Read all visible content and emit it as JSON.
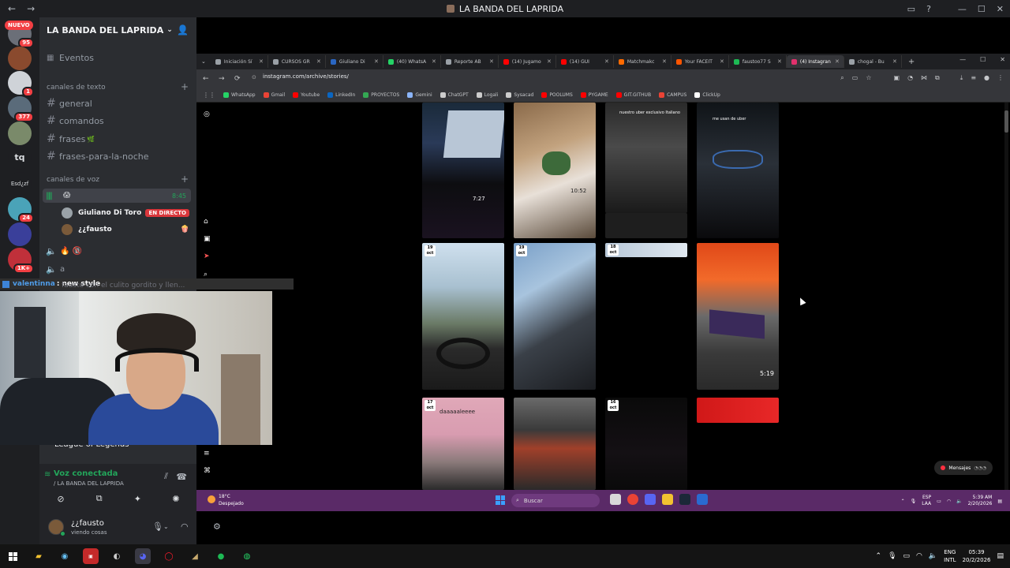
{
  "window": {
    "title": "LA BANDA DEL LAPRIDA",
    "back_label": "←",
    "forward_label": "→",
    "inbox_label": "▭",
    "help_label": "?",
    "minimize_label": "—",
    "maximize_label": "☐",
    "close_label": "✕"
  },
  "rail": {
    "nuevo_label": "NUEVO",
    "servers": [
      {
        "badge": "95",
        "color": "#6b6f78"
      },
      {
        "badge": "",
        "color": "#8a4a2e"
      },
      {
        "badge": "1",
        "color": "#cfd3d8"
      },
      {
        "badge": "377",
        "color": "#5a6b7a"
      },
      {
        "badge": "",
        "color": "#7a8a6a"
      },
      {
        "label": "tq",
        "badge": ""
      },
      {
        "label": "Esd¿zf",
        "badge": ""
      },
      {
        "badge": "24",
        "color": "#4aa3b8"
      },
      {
        "badge": "",
        "color": "#3a3f9a"
      },
      {
        "badge": "1K+",
        "color": "#c0303a"
      }
    ]
  },
  "sidebar": {
    "server_name": "LA BANDA DEL LAPRIDA",
    "chevron": "⌄",
    "events_label": "Eventos",
    "text_category": "canales de texto",
    "text_channels": [
      "general",
      "comandos",
      "frases",
      "frases-para-la-noche"
    ],
    "voice_category": "canales de voz",
    "active_voice": {
      "emoji": "😱",
      "time": "8:45"
    },
    "voice_users": [
      {
        "name": "Giuliano Di Toro",
        "live": "EN DIRECTO"
      },
      {
        "name": "¿¿fausto",
        "live": ""
      }
    ],
    "other_voice": [
      {
        "name": "🔥 🔞"
      },
      {
        "name": "a"
      }
    ],
    "game_activity": "League of Legends",
    "voice_connected": "Voz conectada",
    "voice_server": "/ LA BANDA DEL LAPRIDA",
    "user": {
      "name": "¿¿fausto",
      "status": "viendo cosas"
    }
  },
  "overlay": {
    "chat_user": "valentinna",
    "chat_sep": ":",
    "chat_msg": "new style",
    "ghost_msg": "fausto con el culito gordito y llen..."
  },
  "browser": {
    "tabs": [
      {
        "label": "Iniciación Sí",
        "color": "#9aa0a6"
      },
      {
        "label": "CURSOS GR",
        "color": "#9aa0a6"
      },
      {
        "label": "Giuliano Di",
        "color": "#2a66c2"
      },
      {
        "label": "(40) WhatsA",
        "color": "#25d366"
      },
      {
        "label": "Reporte AB",
        "color": "#9aa0a6"
      },
      {
        "label": "(14) Jugamo",
        "color": "#ff0000"
      },
      {
        "label": "(14) GUI",
        "color": "#ff0000"
      },
      {
        "label": "Matchmakc",
        "color": "#ff6a00"
      },
      {
        "label": "Your FACEIT",
        "color": "#ff5500"
      },
      {
        "label": "faustoo77 S",
        "color": "#1db954"
      },
      {
        "label": "(4) Instagran",
        "color": "#e1306c",
        "active": true
      },
      {
        "label": "chogal - Bu",
        "color": "#9aa0a6"
      }
    ],
    "new_tab": "+",
    "url": "instagram.com/archive/stories/",
    "bookmarks": [
      {
        "label": "WhatsApp",
        "color": "#25d366"
      },
      {
        "label": "Gmail",
        "color": "#ea4335"
      },
      {
        "label": "Youtube",
        "color": "#ff0000"
      },
      {
        "label": "LinkedIn",
        "color": "#0a66c2"
      },
      {
        "label": "PROYECTOS",
        "color": "#34a853"
      },
      {
        "label": "Gemini",
        "color": "#8ab4f8"
      },
      {
        "label": "ChatGPT",
        "color": "#cccccc"
      },
      {
        "label": "Logali",
        "color": "#cccccc"
      },
      {
        "label": "Sysacad",
        "color": "#cccccc"
      },
      {
        "label": "POOLUMS",
        "color": "#ff0000"
      },
      {
        "label": "PYGAME",
        "color": "#ff0000"
      },
      {
        "label": "GIT.GITHUB",
        "color": "#ff0000"
      },
      {
        "label": "CAMPUS",
        "color": "#ea4335"
      },
      {
        "label": "ClickUp",
        "color": "#ffffff"
      }
    ],
    "stories": [
      {
        "date": "",
        "caption": "7:27",
        "duration": ""
      },
      {
        "date": "",
        "caption": "10:52",
        "duration": ""
      },
      {
        "date": "",
        "caption": "nuestro uber exclusivo Italiano",
        "duration": ""
      },
      {
        "date": "",
        "caption": "me usan de uber",
        "duration": ""
      },
      {
        "date": "19 oct",
        "caption": "",
        "duration": ""
      },
      {
        "date": "19 oct",
        "caption": "",
        "duration": ""
      },
      {
        "date": "18 oct",
        "caption": "",
        "duration": ""
      },
      {
        "date": "",
        "caption": "",
        "duration": "5:19"
      },
      {
        "date": "17 oct",
        "caption": "daaaaaleeee",
        "duration": ""
      },
      {
        "date": "",
        "caption": "",
        "duration": ""
      },
      {
        "date": "16 oct",
        "caption": "",
        "duration": ""
      },
      {
        "date": "",
        "caption": "",
        "duration": ""
      }
    ],
    "messages_label": "Mensajes",
    "inner_taskbar": {
      "temp": "18°C",
      "weather": "Despejado",
      "search": "Buscar",
      "lang_top": "ESP",
      "lang_bottom": "LAA",
      "time": "5:39 AM",
      "date": "2/20/2026"
    }
  },
  "taskbar": {
    "lang_top": "ENG",
    "lang_bottom": "INTL",
    "time": "05:39",
    "date": "20/2/2026"
  }
}
